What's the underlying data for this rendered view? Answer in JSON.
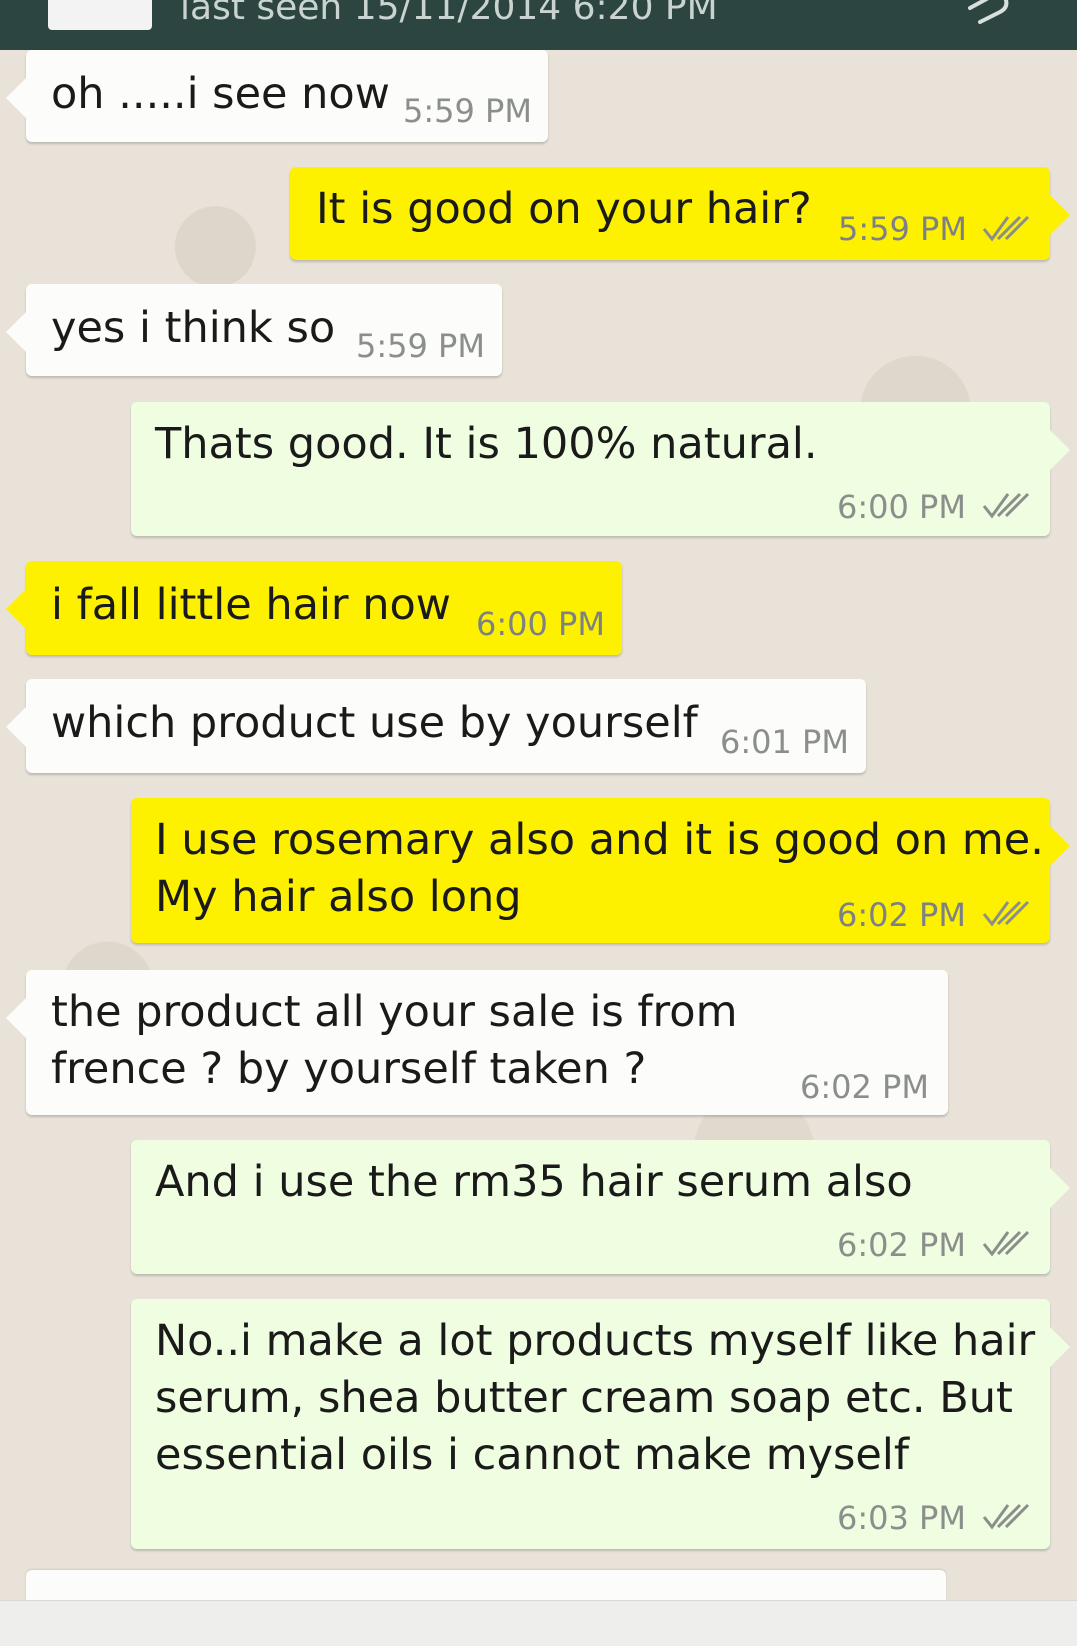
{
  "header": {
    "last_seen": "last seen 15/11/2014 6:20 PM",
    "attach_icon": "paperclip-icon",
    "bar_color": "#2d4540"
  },
  "colors": {
    "incoming": "#fcfcfa",
    "outgoing": "#effde0",
    "highlight": "#fdf100",
    "read_ticks": "#8a8f8c"
  },
  "messages": [
    {
      "direction": "in",
      "text": "oh .....i see now",
      "time": "5:59 PM"
    },
    {
      "direction": "out",
      "text": "It is good on your hair?",
      "time": "5:59 PM",
      "highlighted": true,
      "read": true
    },
    {
      "direction": "in",
      "text": "yes i think so",
      "time": "5:59 PM"
    },
    {
      "direction": "out",
      "text": "Thats good. It is 100% natural.",
      "time": "6:00 PM",
      "read": true
    },
    {
      "direction": "in",
      "text": "i fall little hair now",
      "time": "6:00 PM",
      "highlighted": true
    },
    {
      "direction": "in",
      "text": "which product use by yourself",
      "time": "6:01 PM"
    },
    {
      "direction": "out",
      "text": "I use rosemary also and it is good on me.\nMy hair also long",
      "time": "6:02 PM",
      "highlighted": true,
      "read": true
    },
    {
      "direction": "in",
      "text": "the product all your sale is from\nfrence ? by yourself taken ?",
      "time": "6:02 PM"
    },
    {
      "direction": "out",
      "text": "And i use the rm35 hair serum also",
      "time": "6:02 PM",
      "read": true
    },
    {
      "direction": "out",
      "text": "No..i make a lot products myself like hair\nserum, shea butter cream soap etc. But\nessential oils i cannot make myself",
      "time": "6:03 PM",
      "read": true
    }
  ]
}
